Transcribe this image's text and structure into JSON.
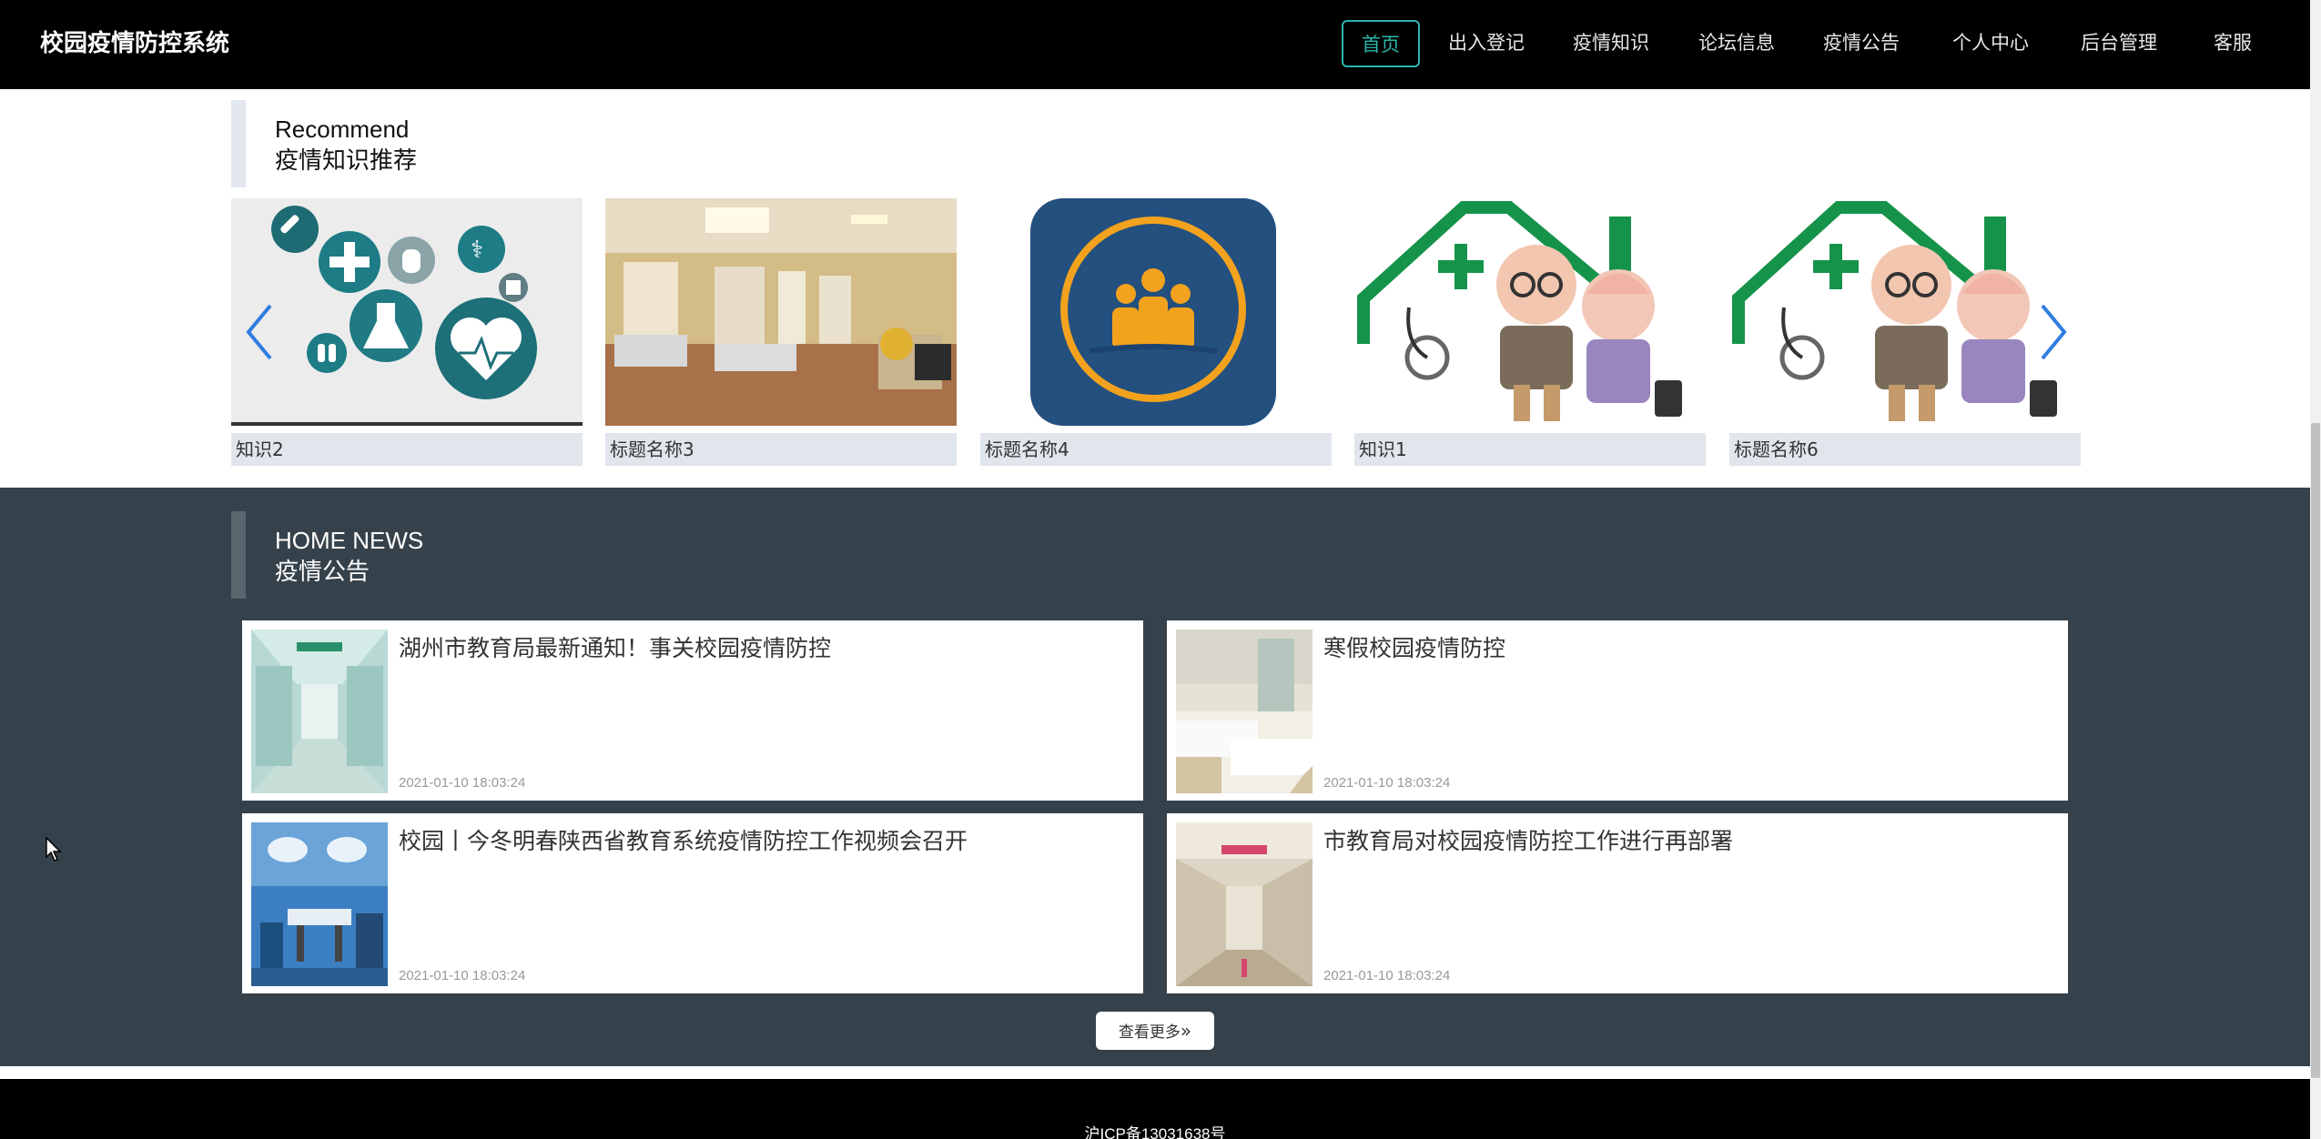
{
  "header": {
    "brand": "校园疫情防控系统",
    "nav": [
      "首页",
      "出入登记",
      "疫情知识",
      "论坛信息",
      "疫情公告",
      "个人中心",
      "后台管理",
      "客服"
    ],
    "active_index": 0
  },
  "recommend": {
    "en": "Recommend",
    "cn": "疫情知识推荐",
    "items": [
      {
        "caption": "知识2"
      },
      {
        "caption": "标题名称3"
      },
      {
        "caption": "标题名称4"
      },
      {
        "caption": "知识1"
      },
      {
        "caption": "标题名称6"
      }
    ]
  },
  "news": {
    "en": "HOME NEWS",
    "cn": "疫情公告",
    "items": [
      {
        "title": "湖州市教育局最新通知！事关校园疫情防控",
        "date": "2021-01-10 18:03:24"
      },
      {
        "title": "寒假校园疫情防控",
        "date": "2021-01-10 18:03:24"
      },
      {
        "title": "校园丨今冬明春陕西省教育系统疫情防控工作视频会召开",
        "date": "2021-01-10 18:03:24"
      },
      {
        "title": "市教育局对校园疫情防控工作进行再部署",
        "date": "2021-01-10 18:03:24"
      }
    ],
    "more_label": "查看更多"
  },
  "footer": {
    "icp": "沪ICP备13031638号"
  },
  "colors": {
    "accent": "#2bb5ab",
    "header_bg": "#000000",
    "news_bg": "#36424b",
    "caption_bg": "#e1e5ec",
    "arrow": "#2f7de1"
  }
}
